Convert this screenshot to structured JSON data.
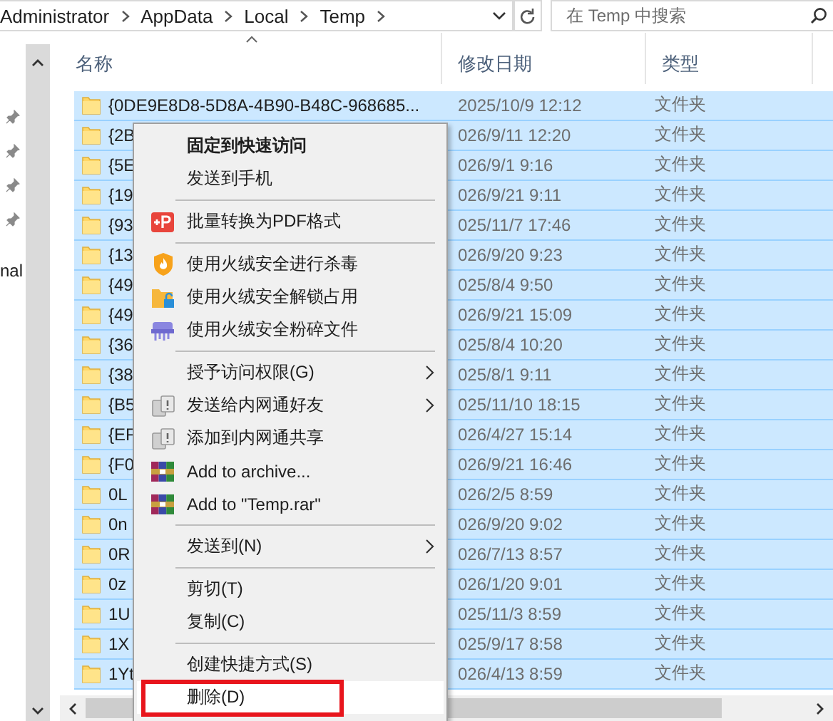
{
  "address_bar": {
    "breadcrumbs": [
      "Administrator",
      "AppData",
      "Local",
      "Temp"
    ]
  },
  "search": {
    "placeholder": "在 Temp 中搜索"
  },
  "nav_pane": {
    "items": [
      {
        "label": "nal"
      }
    ]
  },
  "columns": [
    {
      "label": "名称",
      "sorted": true
    },
    {
      "label": "修改日期",
      "sorted": false
    },
    {
      "label": "类型",
      "sorted": false
    }
  ],
  "rows": [
    {
      "name": "{0DE9E8D8-5D8A-4B90-B48C-968685...",
      "modified": "2025/10/9 12:12",
      "type": "文件夹",
      "selected": true
    },
    {
      "name": "{2B",
      "modified": "026/9/11 12:20",
      "type": "文件夹",
      "selected": true
    },
    {
      "name": "{5E",
      "modified": "026/9/1 9:16",
      "type": "文件夹",
      "selected": true
    },
    {
      "name": "{19",
      "modified": "026/9/21 9:11",
      "type": "文件夹",
      "selected": true
    },
    {
      "name": "{93",
      "modified": "025/11/7 17:46",
      "type": "文件夹",
      "selected": true
    },
    {
      "name": "{13",
      "modified": "026/9/20 9:23",
      "type": "文件夹",
      "selected": true
    },
    {
      "name": "{49",
      "modified": "025/8/4 9:50",
      "type": "文件夹",
      "selected": true
    },
    {
      "name": "{49",
      "modified": "026/9/21 15:09",
      "type": "文件夹",
      "selected": true
    },
    {
      "name": "{36",
      "modified": "025/8/4 10:20",
      "type": "文件夹",
      "selected": true
    },
    {
      "name": "{38",
      "modified": "025/8/1 9:11",
      "type": "文件夹",
      "selected": true
    },
    {
      "name": "{B5",
      "modified": "025/11/10 18:15",
      "type": "文件夹",
      "selected": true
    },
    {
      "name": "{EF",
      "modified": "026/4/27 15:14",
      "type": "文件夹",
      "selected": true
    },
    {
      "name": "{F0",
      "modified": "026/9/21 16:46",
      "type": "文件夹",
      "selected": true
    },
    {
      "name": "0L",
      "modified": "026/2/5 8:59",
      "type": "文件夹",
      "selected": true
    },
    {
      "name": "0n",
      "modified": "026/9/20 9:02",
      "type": "文件夹",
      "selected": true
    },
    {
      "name": "0R",
      "modified": "026/7/13 8:57",
      "type": "文件夹",
      "selected": true
    },
    {
      "name": "0z",
      "modified": "026/1/20 9:01",
      "type": "文件夹",
      "selected": true
    },
    {
      "name": "1U",
      "modified": "025/11/3 8:59",
      "type": "文件夹",
      "selected": true
    },
    {
      "name": "1X",
      "modified": "025/9/17 8:58",
      "type": "文件夹",
      "selected": true
    },
    {
      "name": "1Yt",
      "modified": "026/4/13 8:59",
      "type": "文件夹",
      "selected": true
    }
  ],
  "context_menu": {
    "items": [
      {
        "kind": "item",
        "label": "固定到快速访问",
        "default": true,
        "submenu": false,
        "selected": false,
        "marked": false
      },
      {
        "kind": "item",
        "label": "发送到手机",
        "default": false,
        "submenu": false,
        "selected": false,
        "marked": false
      },
      {
        "kind": "separator"
      },
      {
        "kind": "pdf",
        "label": "批量转换为PDF格式",
        "default": false,
        "submenu": false,
        "selected": false,
        "marked": false
      },
      {
        "kind": "separator"
      },
      {
        "kind": "shield",
        "label": "使用火绒安全进行杀毒",
        "default": false,
        "submenu": false,
        "selected": false,
        "marked": false
      },
      {
        "kind": "folder-lock",
        "label": "使用火绒安全解锁占用",
        "default": false,
        "submenu": false,
        "selected": false,
        "marked": false
      },
      {
        "kind": "shredder",
        "label": "使用火绒安全粉碎文件",
        "default": false,
        "submenu": false,
        "selected": false,
        "marked": false
      },
      {
        "kind": "separator"
      },
      {
        "kind": "item",
        "label": "授予访问权限(G)",
        "default": false,
        "submenu": true,
        "selected": false,
        "marked": false
      },
      {
        "kind": "share",
        "label": "发送给内网通好友",
        "default": false,
        "submenu": true,
        "selected": false,
        "marked": false
      },
      {
        "kind": "share",
        "label": "添加到内网通共享",
        "default": false,
        "submenu": false,
        "selected": false,
        "marked": false
      },
      {
        "kind": "archive",
        "label": "Add to archive...",
        "default": false,
        "submenu": false,
        "selected": false,
        "marked": false
      },
      {
        "kind": "archive",
        "label": "Add to \"Temp.rar\"",
        "default": false,
        "submenu": false,
        "selected": false,
        "marked": false
      },
      {
        "kind": "separator"
      },
      {
        "kind": "item",
        "label": "发送到(N)",
        "default": false,
        "submenu": true,
        "selected": false,
        "marked": false
      },
      {
        "kind": "separator"
      },
      {
        "kind": "item",
        "label": "剪切(T)",
        "default": false,
        "submenu": false,
        "selected": false,
        "marked": false
      },
      {
        "kind": "item",
        "label": "复制(C)",
        "default": false,
        "submenu": false,
        "selected": false,
        "marked": false
      },
      {
        "kind": "separator"
      },
      {
        "kind": "item",
        "label": "创建快捷方式(S)",
        "default": false,
        "submenu": false,
        "selected": false,
        "marked": false
      },
      {
        "kind": "item",
        "label": "删除(D)",
        "default": false,
        "submenu": false,
        "selected": true,
        "marked": true
      }
    ]
  }
}
